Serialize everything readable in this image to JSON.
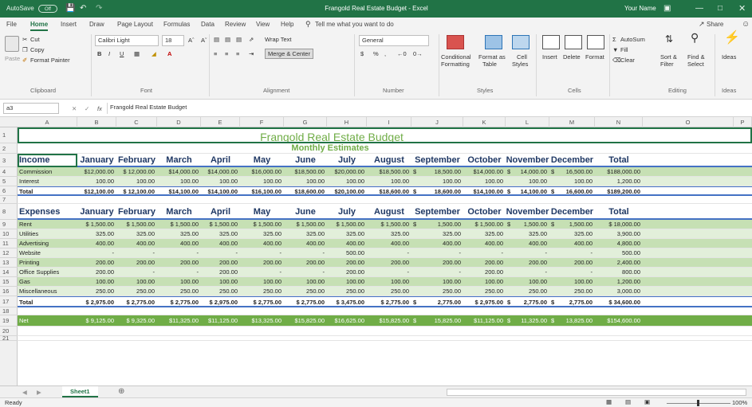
{
  "titlebar": {
    "autosave": "AutoSave",
    "autosave_state": "Off",
    "title": "Frangold Real Estate Budget  -  Excel",
    "user": "Your Name"
  },
  "tabs": [
    "File",
    "Home",
    "Insert",
    "Draw",
    "Page Layout",
    "Formulas",
    "Data",
    "Review",
    "View",
    "Help"
  ],
  "tell_me": "Tell me what you want to do",
  "share": "Share",
  "ribbon": {
    "cut": "Cut",
    "copy": "Copy",
    "paste": "Paste",
    "format_painter": "Format Painter",
    "clipboard": "Clipboard",
    "font_name": "Calibri Light",
    "font_size": "18",
    "font": "Font",
    "wrap_text": "Wrap Text",
    "merge_center": "Merge & Center",
    "alignment": "Alignment",
    "number_format": "General",
    "number": "Number",
    "conditional": "Conditional",
    "conditional2": "Formatting",
    "format_as": "Format as",
    "format_as2": "Table",
    "cell_styles": "Cell",
    "cell_styles2": "Styles",
    "styles": "Styles",
    "insert": "Insert",
    "delete": "Delete",
    "format": "Format",
    "cells": "Cells",
    "autosum": "AutoSum",
    "fill": "Fill",
    "clear": "Clear",
    "sort": "Sort &",
    "sort2": "Filter",
    "find": "Find &",
    "find2": "Select",
    "editing": "Editing",
    "ideas": "Ideas",
    "ideas_grp": "Ideas"
  },
  "formula": {
    "namebox": "a3",
    "value": "Frangold Real Estate Budget"
  },
  "columns": [
    "A",
    "B",
    "C",
    "D",
    "E",
    "F",
    "G",
    "H",
    "I",
    "J",
    "K",
    "L",
    "M",
    "N",
    "O",
    "P"
  ],
  "title": "Frangold Real Estate Budget",
  "subtitle": "Monthly Estimates",
  "income": {
    "header": [
      "Income",
      "January",
      "February",
      "March",
      "April",
      "May",
      "June",
      "July",
      "August",
      "September",
      "October",
      "November",
      "December",
      "Total"
    ],
    "rows": [
      {
        "r": "4",
        "c": [
          "Commission",
          "$12,000.00",
          "$ 12,000.00",
          "$14,000.00",
          "$14,000.00",
          "$16,000.00",
          "$18,500.00",
          "$20,000.00",
          "$18,500.00",
          "$",
          "18,500.00",
          "$14,000.00",
          "$",
          "14,000.00",
          "$",
          "16,500.00",
          "$188,000.00"
        ]
      },
      {
        "r": "5",
        "c": [
          "Interest",
          "100.00",
          "100.00",
          "100.00",
          "100.00",
          "100.00",
          "100.00",
          "100.00",
          "100.00",
          "",
          "100.00",
          "100.00",
          "",
          "100.00",
          "",
          "100.00",
          "1,200.00"
        ]
      },
      {
        "r": "6",
        "c": [
          "Total",
          "$12,100.00",
          "$ 12,100.00",
          "$14,100.00",
          "$14,100.00",
          "$16,100.00",
          "$18,600.00",
          "$20,100.00",
          "$18,600.00",
          "$",
          "18,600.00",
          "$14,100.00",
          "$",
          "14,100.00",
          "$",
          "16,600.00",
          "$189,200.00"
        ]
      }
    ]
  },
  "expenses": {
    "header": [
      "Expenses",
      "January",
      "February",
      "March",
      "April",
      "May",
      "June",
      "July",
      "August",
      "September",
      "October",
      "November",
      "December",
      "Total"
    ],
    "rows": [
      {
        "r": "9",
        "c": [
          "Rent",
          "$ 1,500.00",
          "$ 1,500.00",
          "$ 1,500.00",
          "$ 1,500.00",
          "$ 1,500.00",
          "$ 1,500.00",
          "$ 1,500.00",
          "$ 1,500.00",
          "$",
          "1,500.00",
          "$ 1,500.00",
          "$",
          "1,500.00",
          "$",
          "1,500.00",
          "$ 18,000.00"
        ]
      },
      {
        "r": "10",
        "c": [
          "Utilities",
          "325.00",
          "325.00",
          "325.00",
          "325.00",
          "325.00",
          "325.00",
          "325.00",
          "325.00",
          "",
          "325.00",
          "325.00",
          "",
          "325.00",
          "",
          "325.00",
          "3,900.00"
        ]
      },
      {
        "r": "11",
        "c": [
          "Advertising",
          "400.00",
          "400.00",
          "400.00",
          "400.00",
          "400.00",
          "400.00",
          "400.00",
          "400.00",
          "",
          "400.00",
          "400.00",
          "",
          "400.00",
          "",
          "400.00",
          "4,800.00"
        ]
      },
      {
        "r": "12",
        "c": [
          "Website",
          "-",
          "-",
          "-",
          "-",
          "-",
          "-",
          "500.00",
          "-",
          "",
          "-",
          "-",
          "",
          "-",
          "",
          "-",
          "500.00"
        ]
      },
      {
        "r": "13",
        "c": [
          "Printing",
          "200.00",
          "200.00",
          "200.00",
          "200.00",
          "200.00",
          "200.00",
          "200.00",
          "200.00",
          "",
          "200.00",
          "200.00",
          "",
          "200.00",
          "",
          "200.00",
          "2,400.00"
        ]
      },
      {
        "r": "14",
        "c": [
          "Office Supplies",
          "200.00",
          "-",
          "-",
          "200.00",
          "-",
          "-",
          "200.00",
          "-",
          "",
          "-",
          "200.00",
          "",
          "-",
          "",
          "-",
          "800.00"
        ]
      },
      {
        "r": "15",
        "c": [
          "Gas",
          "100.00",
          "100.00",
          "100.00",
          "100.00",
          "100.00",
          "100.00",
          "100.00",
          "100.00",
          "",
          "100.00",
          "100.00",
          "",
          "100.00",
          "",
          "100.00",
          "1,200.00"
        ]
      },
      {
        "r": "16",
        "c": [
          "Miscellaneous",
          "250.00",
          "250.00",
          "250.00",
          "250.00",
          "250.00",
          "250.00",
          "250.00",
          "250.00",
          "",
          "250.00",
          "250.00",
          "",
          "250.00",
          "",
          "250.00",
          "3,000.00"
        ]
      },
      {
        "r": "17",
        "c": [
          "Total",
          "$ 2,975.00",
          "$ 2,775.00",
          "$ 2,775.00",
          "$ 2,975.00",
          "$ 2,775.00",
          "$ 2,775.00",
          "$ 3,475.00",
          "$ 2,775.00",
          "$",
          "2,775.00",
          "$ 2,975.00",
          "$",
          "2,775.00",
          "$",
          "2,775.00",
          "$ 34,600.00"
        ]
      }
    ]
  },
  "net": {
    "r": "19",
    "c": [
      "Net",
      "$ 9,125.00",
      "$ 9,325.00",
      "$11,325.00",
      "$11,125.00",
      "$13,325.00",
      "$15,825.00",
      "$16,625.00",
      "$15,825.00",
      "$",
      "15,825.00",
      "$11,125.00",
      "$",
      "11,325.00",
      "$",
      "13,825.00",
      "$154,600.00"
    ]
  },
  "rownums": [
    "1",
    "2",
    "3",
    "4",
    "5",
    "6",
    "7",
    "8",
    "9",
    "10",
    "11",
    "12",
    "13",
    "14",
    "15",
    "16",
    "17",
    "18",
    "19",
    "20",
    "21"
  ],
  "sheet": "Sheet1",
  "status": "Ready",
  "zoom": "100%"
}
